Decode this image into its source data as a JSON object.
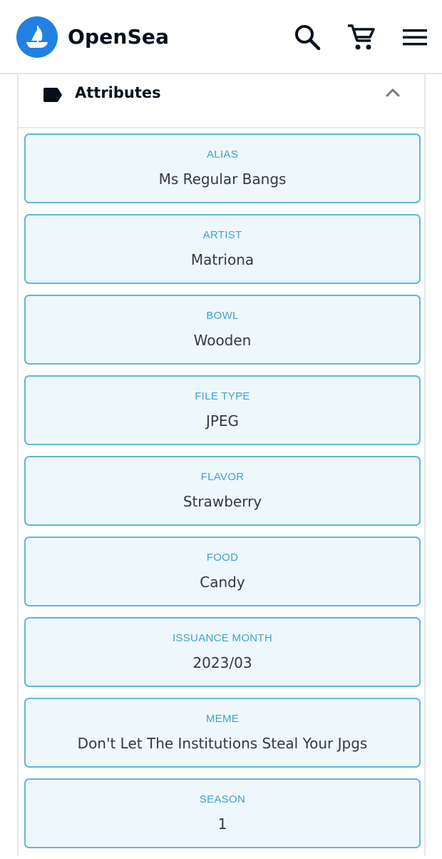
{
  "header": {
    "brand": "OpenSea",
    "brand_color": "#2081e2",
    "icons": [
      "opensea-logo-icon",
      "search-icon",
      "cart-icon",
      "menu-icon"
    ]
  },
  "panel": {
    "title": "Attributes",
    "title_icon": "tag-icon",
    "toggle_icon": "chevron-up-icon",
    "expanded": true
  },
  "attributes": [
    {
      "trait_type": "ALIAS",
      "value": "Ms Regular Bangs"
    },
    {
      "trait_type": "ARTIST",
      "value": "Matriona"
    },
    {
      "trait_type": "BOWL",
      "value": "Wooden"
    },
    {
      "trait_type": "FILE TYPE",
      "value": "JPEG"
    },
    {
      "trait_type": "FLAVOR",
      "value": "Strawberry"
    },
    {
      "trait_type": "FOOD",
      "value": "Candy"
    },
    {
      "trait_type": "ISSUANCE MONTH",
      "value": "2023/03"
    },
    {
      "trait_type": "MEME",
      "value": "Don't Let The Institutions Steal Your Jpgs"
    },
    {
      "trait_type": "SEASON",
      "value": "1"
    }
  ],
  "colors": {
    "card_border": "#5fb8d9",
    "card_background": "#eef7fc",
    "trait_label": "#3ea3cf",
    "trait_value": "#353840"
  }
}
